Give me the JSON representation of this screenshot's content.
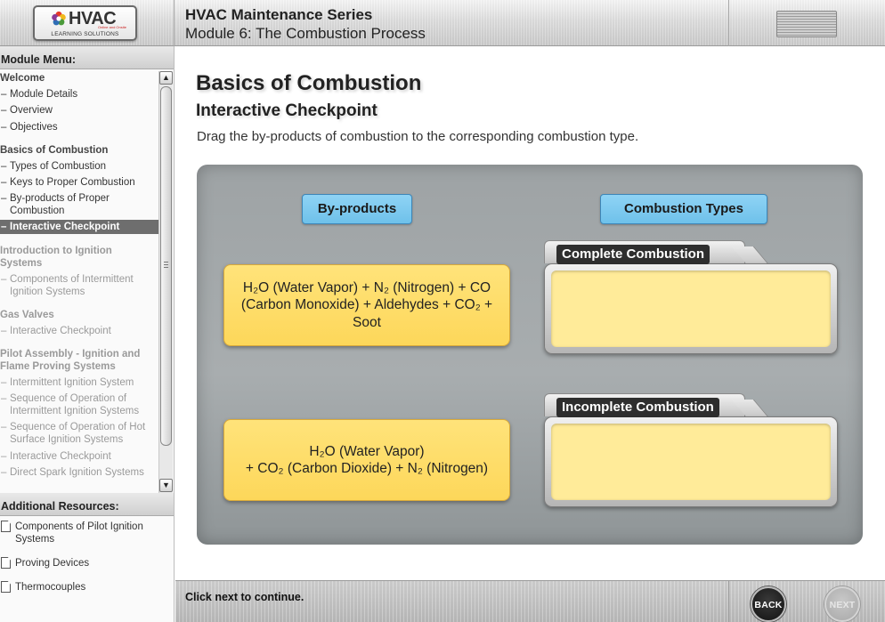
{
  "header": {
    "logo_brand": "HVAC",
    "logo_subtitle": "LEARNING SOLUTIONS",
    "logo_tiny": "Online and Onsite",
    "series_title": "HVAC Maintenance Series",
    "module_title": "Module 6: The Combustion Process"
  },
  "sidebar": {
    "menu_heading": "Module Menu:",
    "items": [
      {
        "label": "Welcome"
      },
      {
        "label": "Module Details"
      },
      {
        "label": "Overview"
      },
      {
        "label": "Objectives"
      },
      {
        "label": "Basics of Combustion"
      },
      {
        "label": "Types of Combustion"
      },
      {
        "label": "Keys to Proper Combustion"
      },
      {
        "label": "By-products of Proper"
      },
      {
        "label": "Combustion"
      },
      {
        "label": "Interactive Checkpoint"
      },
      {
        "label": "Introduction to Ignition"
      },
      {
        "label": "Systems"
      },
      {
        "label": "Components of Intermittent"
      },
      {
        "label": "Ignition Systems"
      },
      {
        "label": "Gas Valves"
      },
      {
        "label": "Interactive Checkpoint"
      },
      {
        "label": "Pilot Assembly - Ignition and"
      },
      {
        "label": "Flame Proving Systems"
      },
      {
        "label": "Intermittent Ignition System"
      },
      {
        "label": "Sequence of Operation of"
      },
      {
        "label": "Intermittent Ignition Systems"
      },
      {
        "label": "Sequence of Operation of Hot"
      },
      {
        "label": "Surface Ignition Systems"
      },
      {
        "label": "Interactive Checkpoint"
      },
      {
        "label": "Direct Spark Ignition Systems"
      }
    ],
    "resources_heading": "Additional Resources:",
    "resources": [
      {
        "line1": "Components of Pilot Ignition",
        "line2": "Systems"
      },
      {
        "line1": "Proving Devices",
        "line2": ""
      },
      {
        "line1": "Thermocouples",
        "line2": ""
      }
    ]
  },
  "content": {
    "title": "Basics of Combustion",
    "subtitle": "Interactive Checkpoint",
    "instructions": "Drag the by-products of combustion to the corresponding combustion type.",
    "byproducts_label": "By-products",
    "types_label": "Combustion Types",
    "cards": [
      {
        "lines": [
          "H₂O (Water Vapor) + N₂ (Nitrogen) + CO",
          "(Carbon Monoxide) + Aldehydes + CO₂ +",
          "Soot"
        ]
      },
      {
        "lines": [
          "H₂O (Water Vapor)",
          "+ CO₂ (Carbon Dioxide) + N₂ (Nitrogen)"
        ]
      }
    ],
    "targets": [
      {
        "label": "Complete Combustion"
      },
      {
        "label": "Incomplete Combustion"
      }
    ]
  },
  "footer": {
    "message": "Click next to continue.",
    "back_label": "BACK",
    "next_label": "NEXT"
  },
  "colors": {
    "accent_blue": "#7cc9ef",
    "card_yellow": "#fdd75a",
    "drop_zone": "#ffeb99",
    "panel_gray": "#a3a8aa",
    "active_menu": "#6e6e6e"
  }
}
